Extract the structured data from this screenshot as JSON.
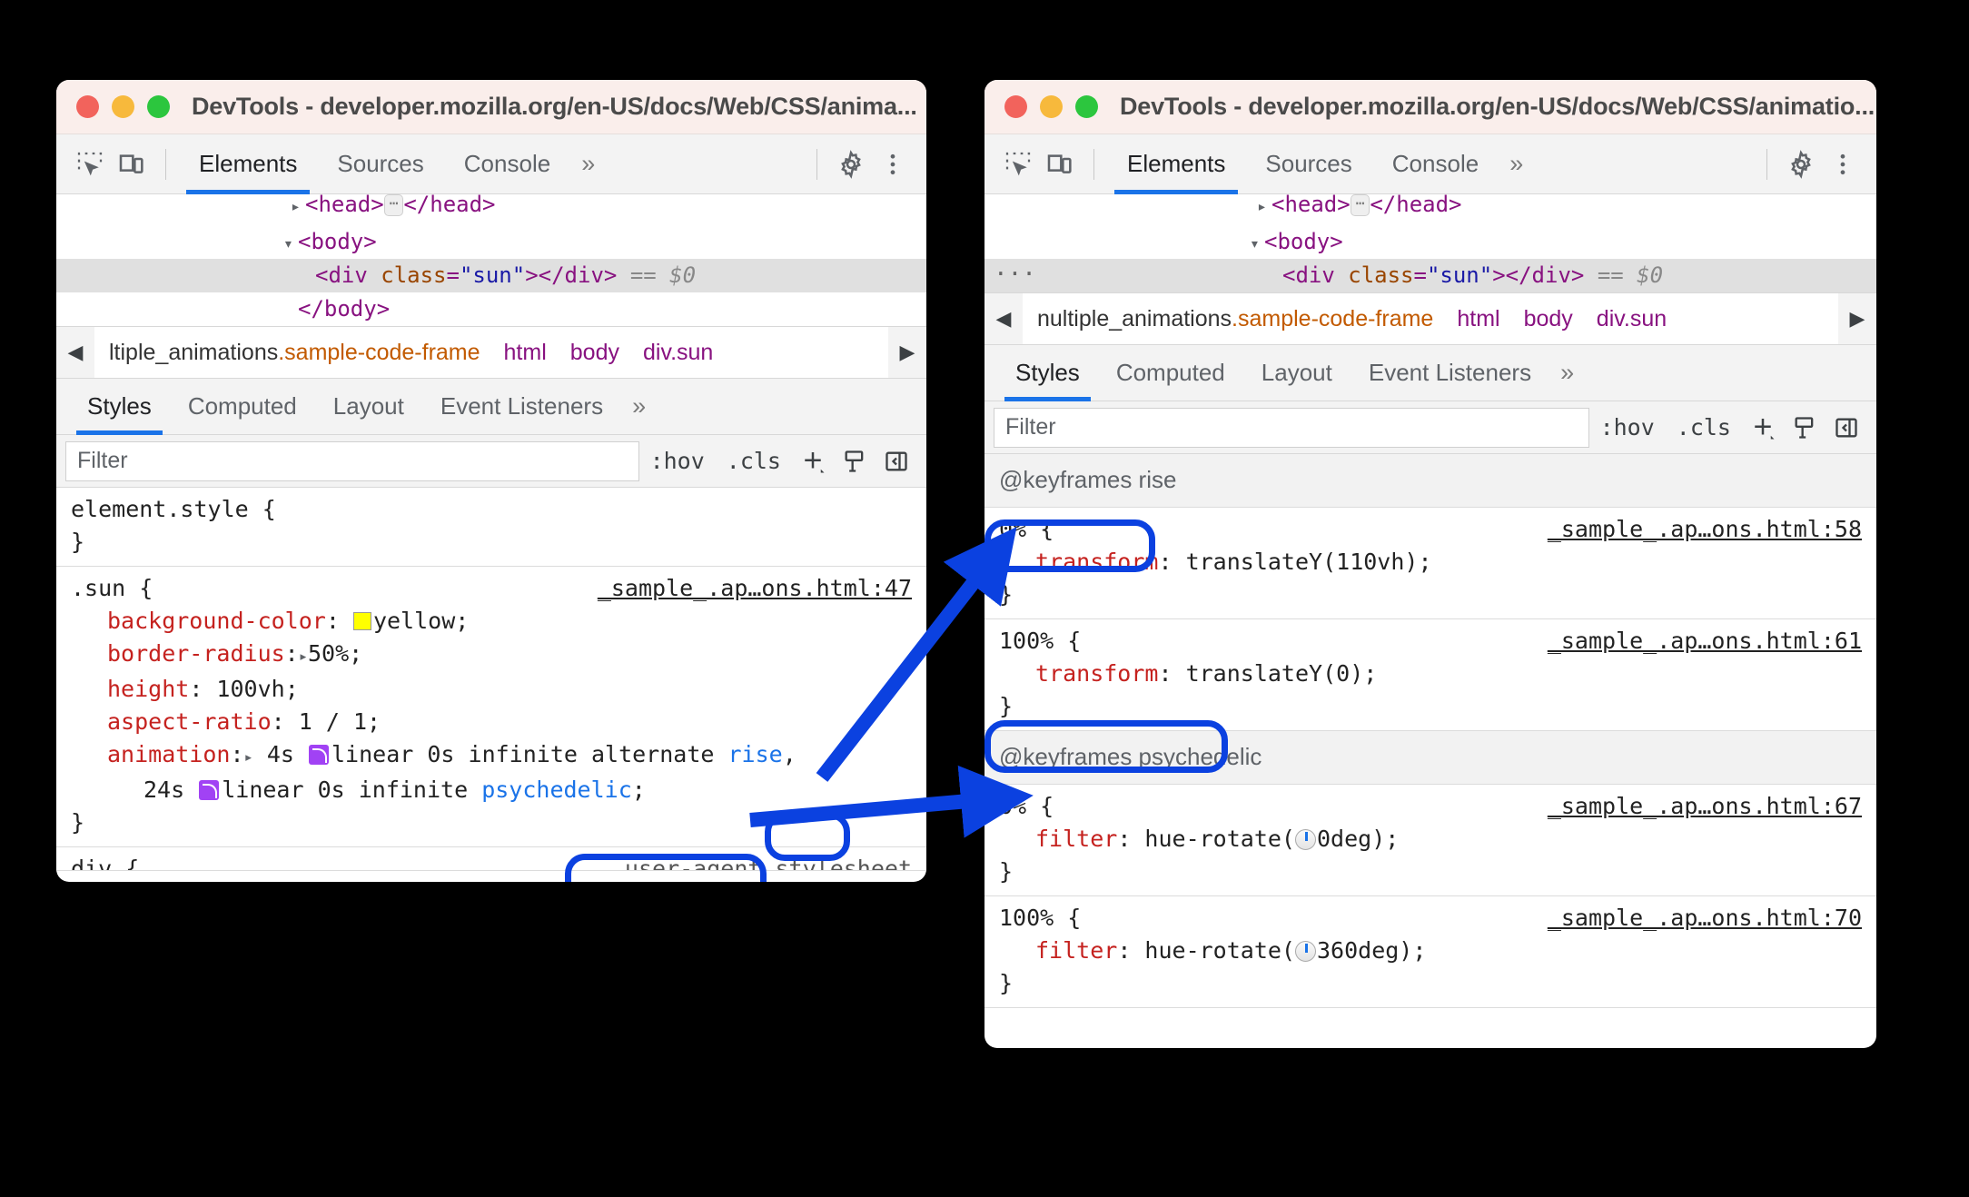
{
  "window_left": {
    "title": "DevTools - developer.mozilla.org/en-US/docs/Web/CSS/anima...",
    "toolbar": {
      "inspect_icon": "inspect-element-icon",
      "device_icon": "device-toolbar-icon",
      "tabs": [
        "Elements",
        "Sources",
        "Console"
      ],
      "more_tabs": "»",
      "settings_icon": "gear-icon",
      "menu_icon": "kebab-menu-icon"
    },
    "dom": [
      {
        "text": "<head> ··· </head>",
        "type": "head"
      },
      {
        "text": "<body>",
        "type": "body-open"
      },
      {
        "text": "<div class=\"sun\"></div> == $0",
        "type": "div-sun",
        "selected": true
      },
      {
        "text": "</body>",
        "type": "body-close"
      }
    ],
    "breadcrumb": {
      "back_arrow": "◀",
      "forward_arrow": "▶",
      "items": [
        {
          "name": "ltiple_animations",
          "suffix": ".sample-code-frame"
        },
        {
          "name": "html"
        },
        {
          "name": "body"
        },
        {
          "name": "div.sun"
        }
      ]
    },
    "pane_tabs": [
      "Styles",
      "Computed",
      "Layout",
      "Event Listeners"
    ],
    "pane_tabs_more": "»",
    "filter": {
      "placeholder": "Filter",
      "value": "",
      "hov": ":hov",
      "cls": ".cls",
      "add_icon": "plus-new-rule-icon",
      "print_icon": "print-styles-icon",
      "sidebar_icon": "toggle-sidebar-icon"
    },
    "rules": [
      {
        "selector": "element.style {",
        "source": "",
        "declarations": [],
        "close": "}"
      },
      {
        "selector": ".sun {",
        "source": "_sample_.ap…ons.html:47",
        "declarations": [
          {
            "prop": "background-color",
            "value": "yellow",
            "swatch": "#ffff00"
          },
          {
            "prop": "border-radius",
            "value": "50%",
            "expandable": true
          },
          {
            "prop": "height",
            "value": "100vh"
          },
          {
            "prop": "aspect-ratio",
            "value": "1 / 1"
          },
          {
            "prop": "animation",
            "value": "4s linear 0s infinite alternate rise,",
            "expandable": true,
            "easing": true,
            "anim_name": "rise"
          },
          {
            "prop": "",
            "value": "24s linear 0s infinite psychedelic;",
            "easing": true,
            "anim_name": "psychedelic",
            "continuation": true
          }
        ],
        "close": "}"
      },
      {
        "selector": "div {",
        "source": "user-agent stylesheet",
        "declarations": [],
        "close": "",
        "cut_off": true
      }
    ],
    "highlights": [
      {
        "target": "rise",
        "label": "rise"
      },
      {
        "target": "psychedelic",
        "label": "psychedelic;"
      }
    ]
  },
  "window_right": {
    "title": "DevTools - developer.mozilla.org/en-US/docs/Web/CSS/animatio...",
    "toolbar": {
      "inspect_icon": "inspect-element-icon",
      "device_icon": "device-toolbar-icon",
      "tabs": [
        "Elements",
        "Sources",
        "Console"
      ],
      "more_tabs": "»",
      "settings_icon": "gear-icon",
      "menu_icon": "kebab-menu-icon"
    },
    "dom": [
      {
        "text": "<head> ··· </head>",
        "type": "head"
      },
      {
        "text": "<body>",
        "type": "body-open"
      },
      {
        "text": "<div class=\"sun\"></div> == $0",
        "type": "div-sun",
        "selected": true,
        "badge": "···"
      }
    ],
    "breadcrumb": {
      "back_arrow": "◀",
      "forward_arrow": "▶",
      "items": [
        {
          "name": "nultiple_animations",
          "suffix": ".sample-code-frame"
        },
        {
          "name": "html"
        },
        {
          "name": "body"
        },
        {
          "name": "div.sun"
        }
      ]
    },
    "pane_tabs": [
      "Styles",
      "Computed",
      "Layout",
      "Event Listeners"
    ],
    "pane_tabs_more": "»",
    "filter": {
      "placeholder": "Filter",
      "value": "",
      "hov": ":hov",
      "cls": ".cls",
      "add_icon": "plus-new-rule-icon",
      "print_icon": "print-styles-icon",
      "sidebar_icon": "toggle-sidebar-icon"
    },
    "keyframe_groups": [
      {
        "name": "@keyframes rise",
        "highlighted": true,
        "frames": [
          {
            "selector": "0% {",
            "source": "_sample_.ap…ons.html:58",
            "prop": "transform",
            "value": "translateY(110vh);",
            "close": "}"
          },
          {
            "selector": "100% {",
            "source": "_sample_.ap…ons.html:61",
            "prop": "transform",
            "value": "translateY(0);",
            "close": "}"
          }
        ]
      },
      {
        "name": "@keyframes psychedelic",
        "highlighted": true,
        "frames": [
          {
            "selector": "0% {",
            "source": "_sample_.ap…ons.html:67",
            "prop": "filter",
            "value": "hue-rotate(0deg);",
            "angle_icon": true,
            "close": "}"
          },
          {
            "selector": "100% {",
            "source": "_sample_.ap…ons.html:70",
            "prop": "filter",
            "value": "hue-rotate(360deg);",
            "angle_icon": true,
            "close": "}"
          }
        ]
      }
    ]
  },
  "annotations": {
    "accent_color": "#0b41e0",
    "arrows": [
      {
        "from": "rise-highlight",
        "to": "keyframes-rise-highlight"
      },
      {
        "from": "psychedelic-highlight",
        "to": "keyframes-psychedelic-highlight"
      }
    ]
  }
}
